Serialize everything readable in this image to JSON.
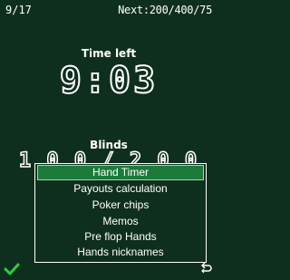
{
  "status_bar": {
    "round_counter": "9/17",
    "next_blinds": "Next:200/400/75"
  },
  "timer": {
    "label": "Time left",
    "value": "9:03"
  },
  "blinds": {
    "label": "Blinds",
    "partial_value": "1 0 0 / 2 0 0"
  },
  "menu": {
    "selected_index": 0,
    "items": [
      {
        "label": "Hand Timer"
      },
      {
        "label": "Payouts calculation"
      },
      {
        "label": "Poker chips"
      },
      {
        "label": "Memos"
      },
      {
        "label": "Pre flop Hands"
      },
      {
        "label": "Hands nicknames"
      }
    ]
  },
  "softkeys": {
    "left_icon": "checkmark-icon",
    "right_icon": "back-arrow-icon"
  },
  "colors": {
    "background": "#0f2f1e",
    "selection": "#1c7a3a",
    "checkmark": "#2ecc40",
    "text": "#ffffff"
  }
}
